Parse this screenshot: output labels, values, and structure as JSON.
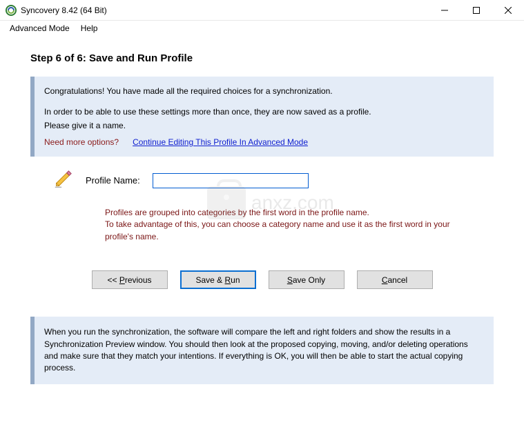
{
  "window": {
    "title": "Syncovery 8.42 (64 Bit)"
  },
  "menu": {
    "advanced": "Advanced Mode",
    "help": "Help"
  },
  "step": {
    "title": "Step 6 of 6: Save and Run Profile"
  },
  "intro": {
    "congrats": "Congratulations! You have made all the required choices for a synchronization.",
    "inorder": "In order to be able to use these settings more than once, they are now saved as a profile.",
    "giveit": "Please give it a name.",
    "need_more": "Need more options?",
    "adv_link": "Continue Editing This Profile In Advanced Mode"
  },
  "profile": {
    "label": "Profile Name:",
    "value": "",
    "hint1": "Profiles are grouped into categories by the first word in the profile name.",
    "hint2": "To take advantage of this, you can choose a category name and use it as the first word in your profile's name."
  },
  "buttons": {
    "previous_pre": "<< ",
    "previous_u": "P",
    "previous_post": "revious",
    "saverun_pre": "Save & ",
    "saverun_u": "R",
    "saverun_post": "un",
    "saveonly_u": "S",
    "saveonly_post": "ave Only",
    "cancel_u": "C",
    "cancel_post": "ancel"
  },
  "bottom": {
    "text": "When you run the synchronization, the software will compare the left and right folders and show the results in a Synchronization Preview window. You should then look at the proposed copying, moving, and/or deleting operations and make sure that they match your intentions. If everything is OK, you will then be able to start the actual copying process."
  },
  "watermark": {
    "text": "anxz.com"
  }
}
